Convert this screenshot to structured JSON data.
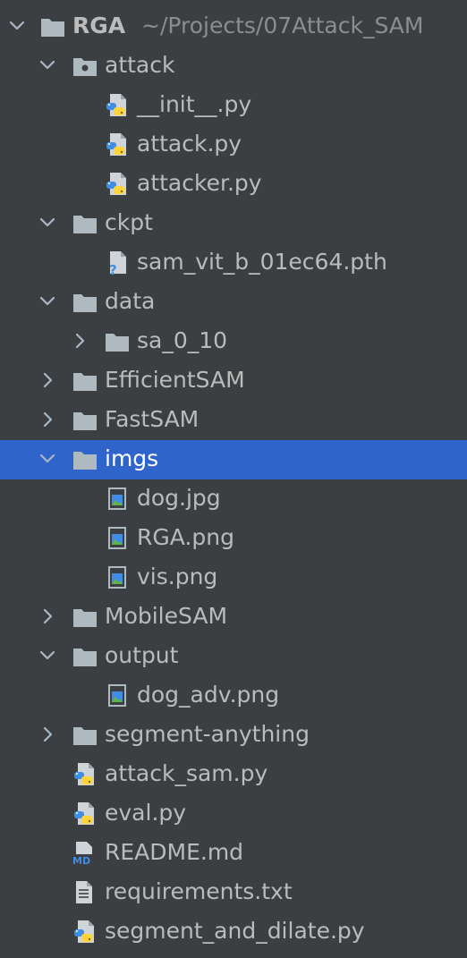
{
  "project_tree": {
    "root": {
      "name": "RGA",
      "path": "~/Projects/07Attack_SAM"
    },
    "attack": {
      "name": "attack",
      "files": [
        "__init__.py",
        "attack.py",
        "attacker.py"
      ]
    },
    "ckpt": {
      "name": "ckpt",
      "files": [
        "sam_vit_b_01ec64.pth"
      ]
    },
    "data": {
      "name": "data",
      "children": [
        "sa_0_10"
      ]
    },
    "efficientsam": "EfficientSAM",
    "fastsam": "FastSAM",
    "imgs": {
      "name": "imgs",
      "files": [
        "dog.jpg",
        "RGA.png",
        "vis.png"
      ]
    },
    "mobilesam": "MobileSAM",
    "output": {
      "name": "output",
      "files": [
        "dog_adv.png"
      ]
    },
    "segment_anything": "segment-anything",
    "root_files": [
      "attack_sam.py",
      "eval.py",
      "README.md",
      "requirements.txt",
      "segment_and_dilate.py"
    ]
  },
  "colors": {
    "background": "#3c3f41",
    "selection": "#2f65ca",
    "text": "#bbbbbb",
    "path_text": "#8b8e90",
    "folder": "#aeb9c0",
    "python_blue": "#3e8ee6",
    "python_yellow": "#ffd43b"
  },
  "icons": {
    "expanded": "chevron-down-icon",
    "collapsed": "chevron-right-icon",
    "folder": "folder-icon",
    "package": "package-folder-icon",
    "python": "python-file-icon",
    "unknown": "unknown-file-icon",
    "image": "image-file-icon",
    "markdown": "markdown-file-icon",
    "text": "text-file-icon"
  }
}
